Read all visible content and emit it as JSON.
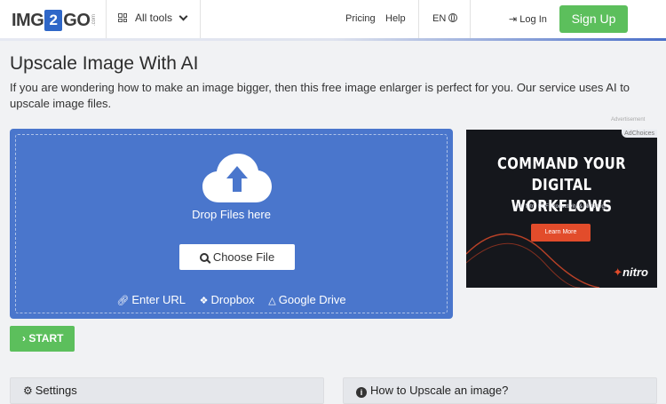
{
  "header": {
    "logo": {
      "part1": "IMG",
      "part2": "2",
      "part3": "GO",
      "suffix": ".com"
    },
    "all_tools_label": "All tools",
    "nav": {
      "pricing": "Pricing",
      "help": "Help",
      "language": "EN"
    },
    "login_label": "Log In",
    "signup_label": "Sign Up"
  },
  "page": {
    "title": "Upscale Image With AI",
    "description": "If you are wondering how to make an image bigger, then this free image enlarger is perfect for you. Our service uses AI to upscale image files."
  },
  "upload": {
    "drop_text": "Drop Files here",
    "choose_file_label": "Choose File",
    "sources": {
      "url": "Enter URL",
      "dropbox": "Dropbox",
      "drive": "Google Drive"
    },
    "start_label": "START"
  },
  "advertisement": {
    "label": "Advertisement",
    "adchoices": "AdChoices",
    "headline_line1": "COMMAND YOUR",
    "headline_line2": "DIGITAL WORKFLOWS",
    "subtext": "with Nitro PDF Productivity & Nitro Sign.",
    "button_label": "Learn More",
    "brand": "nitro"
  },
  "panels": {
    "settings_label": "Settings",
    "howto_label": "How to Upscale an image?"
  },
  "colors": {
    "primary_blue": "#4a76cc",
    "green": "#5cbf5c",
    "ad_accent": "#e24c2b"
  }
}
